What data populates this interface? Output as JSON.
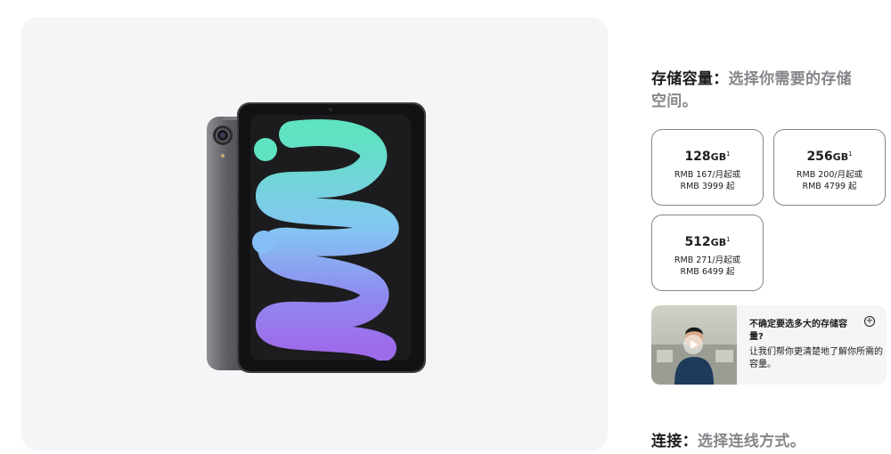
{
  "storage": {
    "heading": "存储容量：",
    "subheading": "选择你需要的存储空间。",
    "options": [
      {
        "capacity": "128",
        "unit": "GB",
        "footnote": "1",
        "monthly": "RMB 167/月起或",
        "price": "RMB 3999 起"
      },
      {
        "capacity": "256",
        "unit": "GB",
        "footnote": "1",
        "monthly": "RMB 200/月起或",
        "price": "RMB 4799 起"
      },
      {
        "capacity": "512",
        "unit": "GB",
        "footnote": "1",
        "monthly": "RMB 271/月起或",
        "price": "RMB 6499 起"
      }
    ]
  },
  "help": {
    "title": "不确定要选多大的存储容量?",
    "description": "让我们帮你更清楚地了解你所需的容量。",
    "expand_icon": "plus-circle-icon",
    "play_icon": "play-icon"
  },
  "connectivity": {
    "heading": "连接：",
    "subheading": "选择连线方式。"
  },
  "colors": {
    "option_border": "#86868b",
    "gallery_bg": "#f5f5f7",
    "muted_text": "#86868b",
    "device_body": "#58585c"
  }
}
